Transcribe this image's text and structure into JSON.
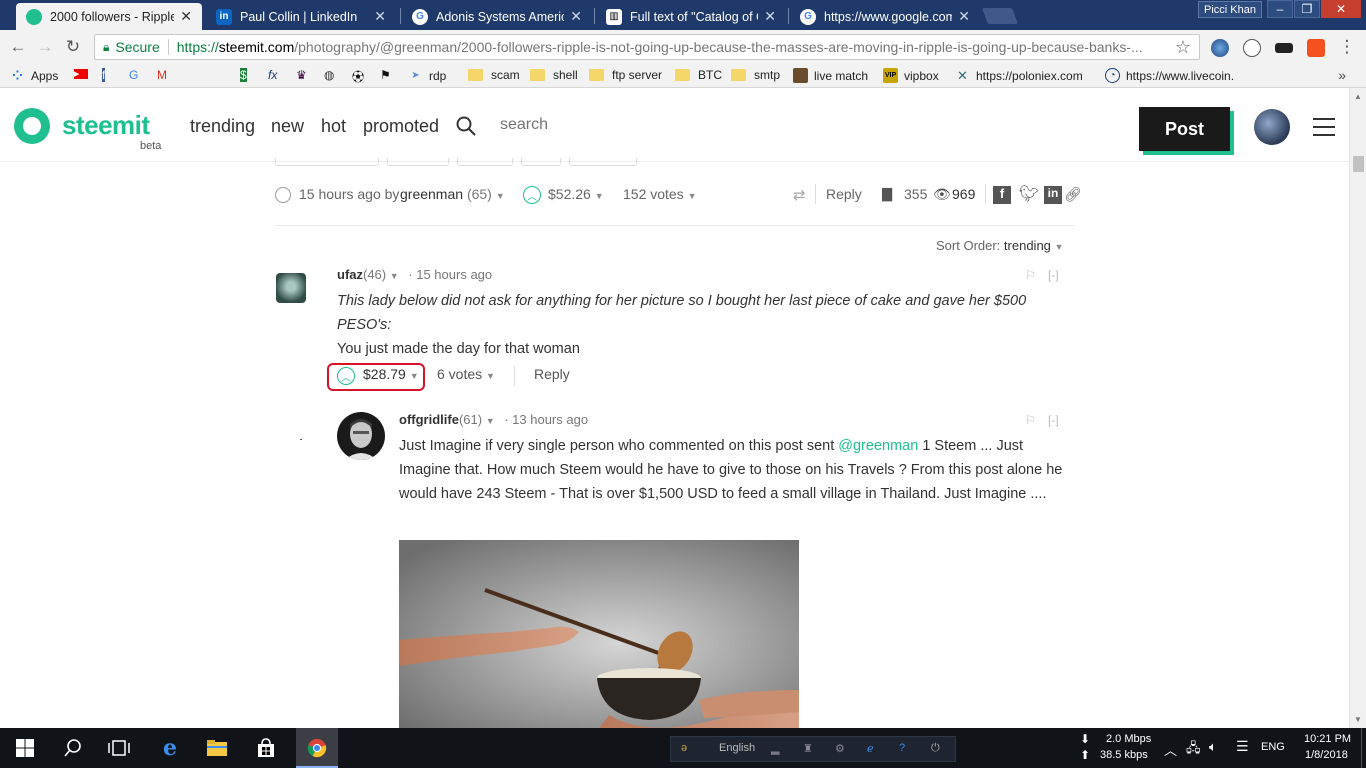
{
  "browser": {
    "tabs": [
      {
        "title": "2000 followers - Ripple is",
        "active": true
      },
      {
        "title": "Paul Collin | LinkedIn",
        "active": false
      },
      {
        "title": "Adonis Systems America",
        "active": false
      },
      {
        "title": "Full text of \"Catalog of C",
        "active": false
      },
      {
        "title": "https://www.google.com",
        "active": false
      }
    ],
    "profile_name": "Picci Khan",
    "address": {
      "secure_label": "Secure",
      "scheme": "https://",
      "host": "steemit.com",
      "path": "/photography/@greenman/2000-followers-ripple-is-not-going-up-because-the-masses-are-moving-in-ripple-is-going-up-because-banks-..."
    },
    "bookmarks": [
      {
        "label": "Apps",
        "icon": "apps-grid-icon"
      },
      {
        "label": "rdp",
        "icon": "send-icon"
      },
      {
        "label": "scam",
        "icon": "folder-icon"
      },
      {
        "label": "shell",
        "icon": "folder-icon"
      },
      {
        "label": "ftp server",
        "icon": "folder-icon"
      },
      {
        "label": "BTC",
        "icon": "folder-icon"
      },
      {
        "label": "smtp",
        "icon": "folder-icon"
      },
      {
        "label": "live match",
        "icon": "person-icon"
      },
      {
        "label": "vipbox",
        "icon": "vip-icon"
      },
      {
        "label": "https://poloniex.com",
        "icon": "poloniex-icon"
      },
      {
        "label": "https://www.livecoin.",
        "icon": "livecoin-icon"
      }
    ]
  },
  "site": {
    "logo_text": "steemit",
    "logo_sub": "beta",
    "nav": [
      "trending",
      "new",
      "hot",
      "promoted"
    ],
    "search_placeholder": "search",
    "post_button": "Post"
  },
  "post_meta": {
    "time": "15 hours ago by",
    "author": "greenman",
    "author_rep": "(65)",
    "payout": "$52.26",
    "votes": "152 votes",
    "reply_label": "Reply",
    "comments_count": "355",
    "views_count": "969"
  },
  "sort": {
    "label": "Sort Order:",
    "value": "trending"
  },
  "comments": [
    {
      "author": "ufaz",
      "rep": "(46)",
      "time": "· 15 hours ago",
      "quote": "This lady below did not ask for anything for her picture so I bought her last piece of cake and gave her $500 PESO's:",
      "text": "You just made the day for that woman",
      "payout": "$28.79",
      "votes": "6 votes",
      "reply_label": "Reply",
      "collapse": "[-]"
    },
    {
      "author": "offgridlife",
      "rep": "(61)",
      "time": "· 13 hours ago",
      "text_before": "Just Imagine if very single person who commented on this post sent",
      "mention": "@greenman",
      "text_after": "1 Steem ... Just Imagine that. How much Steem would he have to give to those on his Travels ? From this post alone he would have 243 Steem - That is over $1,500 USD to feed a small village in Thailand. Just Imagine ....",
      "collapse": "[-]"
    }
  ],
  "taskbar": {
    "ime": "English",
    "net_down": "2.0 Mbps",
    "net_up": "38.5 kbps",
    "lang": "ENG",
    "time": "10:21 PM",
    "date": "1/8/2018"
  },
  "colors": {
    "steemit_green": "#1fbf8f",
    "highlight_red": "#d6132a"
  }
}
